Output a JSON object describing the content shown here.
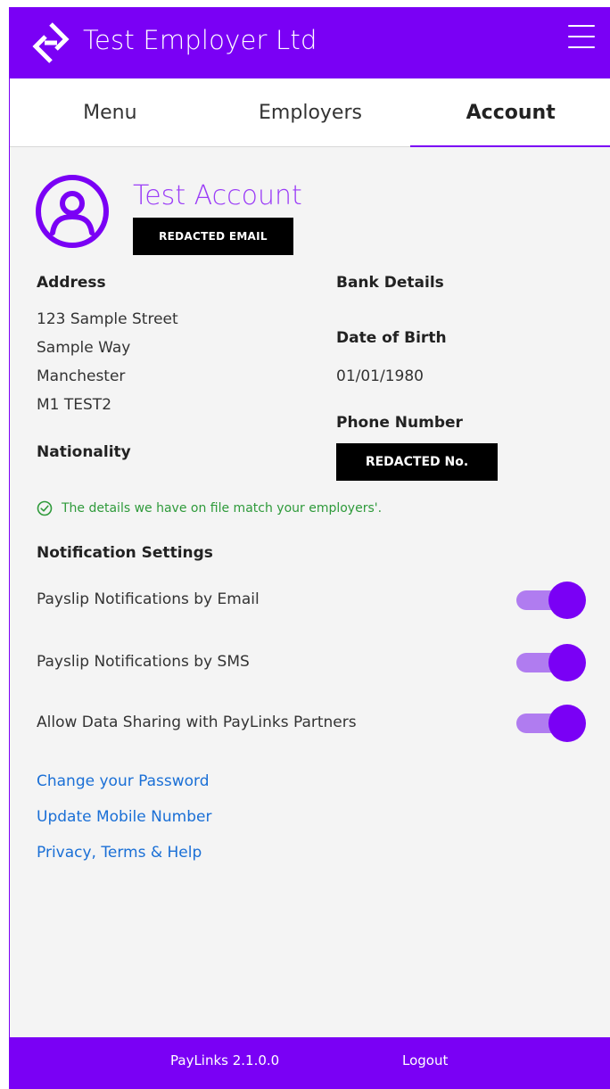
{
  "header": {
    "title": "Test Employer Ltd",
    "logo_icon": "diamond-logo-icon",
    "menu_icon": "hamburger-icon",
    "brand_color": "#7a00f5"
  },
  "tabs": [
    {
      "label": "Menu",
      "active": false
    },
    {
      "label": "Employers",
      "active": false
    },
    {
      "label": "Account",
      "active": true
    }
  ],
  "profile": {
    "name": "Test Account",
    "email": "REDACTED EMAIL",
    "avatar_icon": "user-circle-icon"
  },
  "address": {
    "label": "Address",
    "lines": [
      "123 Sample Street",
      "Sample Way",
      "Manchester",
      "M1 TEST2"
    ]
  },
  "nationality": {
    "label": "Nationality"
  },
  "bank": {
    "label": "Bank Details"
  },
  "dob": {
    "label": "Date of Birth",
    "value": "01/01/1980"
  },
  "phone": {
    "label": "Phone Number",
    "value": "REDACTED No."
  },
  "match_message": "The details we have on file match your employers'.",
  "notifications": {
    "title": "Notification Settings",
    "toggles": [
      {
        "label": "Payslip Notifications by Email",
        "on": true
      },
      {
        "label": "Payslip Notifications by SMS",
        "on": true
      },
      {
        "label": "Allow Data Sharing with PayLinks Partners",
        "on": true
      }
    ]
  },
  "links": [
    {
      "label": "Change your Password"
    },
    {
      "label": "Update Mobile Number"
    },
    {
      "label": "Privacy, Terms & Help"
    }
  ],
  "footer": {
    "version": "PayLinks 2.1.0.0",
    "logout": "Logout"
  }
}
